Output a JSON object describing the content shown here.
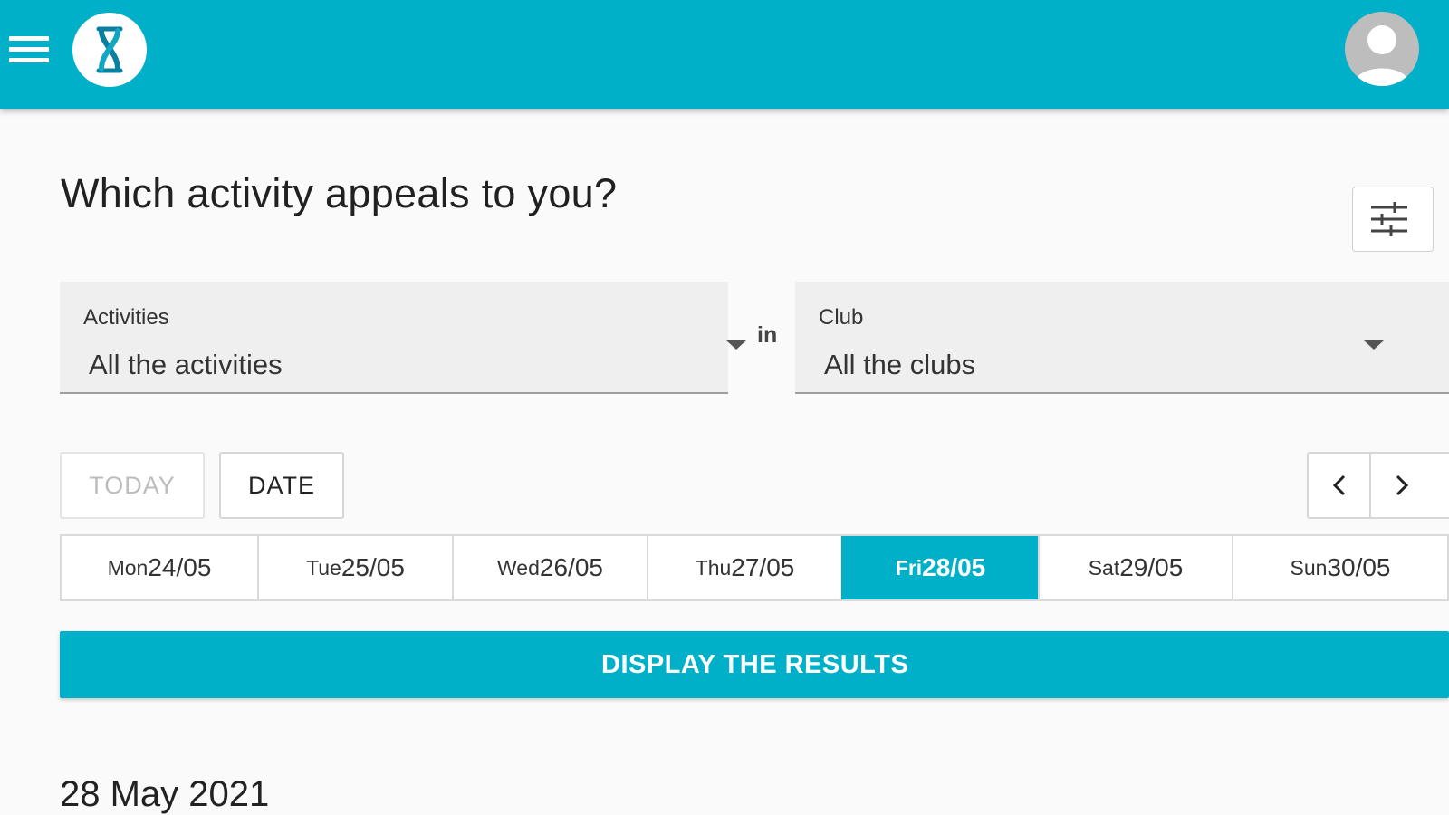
{
  "header": {
    "menu_icon": "hamburger-menu-icon",
    "logo_icon": "hourglass-logo-icon",
    "avatar_icon": "user-avatar-icon",
    "brand_color": "#00b0c9"
  },
  "main": {
    "title": "Which activity appeals to you?",
    "filter_icon": "sliders-icon",
    "activities": {
      "label": "Activities",
      "value": "All the activities"
    },
    "in_label": "in",
    "club": {
      "label": "Club",
      "value": "All the clubs"
    },
    "today_label": "TODAY",
    "date_label": "DATE",
    "prev_icon": "chevron-left-icon",
    "next_icon": "chevron-right-icon",
    "days": [
      {
        "name": "Mon",
        "date": "24/05",
        "selected": false
      },
      {
        "name": "Tue",
        "date": "25/05",
        "selected": false
      },
      {
        "name": "Wed",
        "date": "26/05",
        "selected": false
      },
      {
        "name": "Thu",
        "date": "27/05",
        "selected": false
      },
      {
        "name": "Fri",
        "date": "28/05",
        "selected": true
      },
      {
        "name": "Sat",
        "date": "29/05",
        "selected": false
      },
      {
        "name": "Sun",
        "date": "30/05",
        "selected": false
      }
    ],
    "results_button": "DISPLAY THE RESULTS",
    "date_heading": "28 May 2021"
  }
}
